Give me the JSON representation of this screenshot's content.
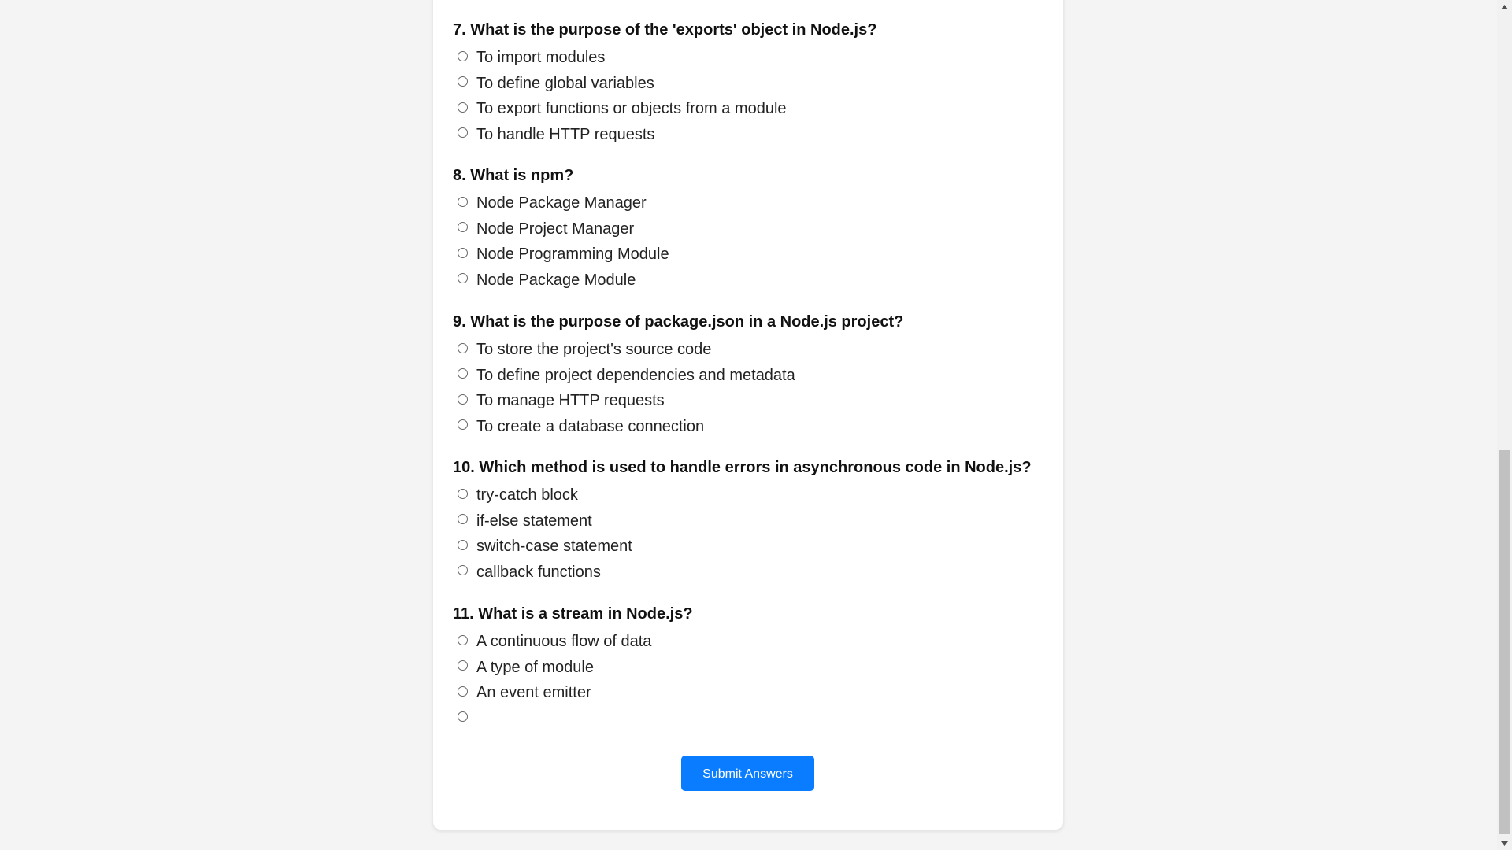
{
  "questions": [
    {
      "title": "7. What is the purpose of the 'exports' object in Node.js?",
      "options": [
        "To import modules",
        "To define global variables",
        "To export functions or objects from a module",
        "To handle HTTP requests"
      ]
    },
    {
      "title": "8. What is npm?",
      "options": [
        "Node Package Manager",
        "Node Project Manager",
        "Node Programming Module",
        "Node Package Module"
      ]
    },
    {
      "title": "9. What is the purpose of package.json in a Node.js project?",
      "options": [
        "To store the project's source code",
        "To define project dependencies and metadata",
        "To manage HTTP requests",
        "To create a database connection"
      ]
    },
    {
      "title": "10. Which method is used to handle errors in asynchronous code in Node.js?",
      "options": [
        "try-catch block",
        "if-else statement",
        "switch-case statement",
        "callback functions"
      ]
    },
    {
      "title": "11. What is a stream in Node.js?",
      "options": [
        "A continuous flow of data",
        "A type of module",
        "An event emitter",
        ""
      ]
    }
  ],
  "submit_label": "Submit Answers",
  "colors": {
    "accent": "#0a7cff",
    "page_bg": "#f4f4f4",
    "card_bg": "#ffffff"
  },
  "icons": {
    "scroll_up": "triangle-up-icon",
    "scroll_down": "triangle-down-icon",
    "radio": "radio-circle-icon"
  }
}
